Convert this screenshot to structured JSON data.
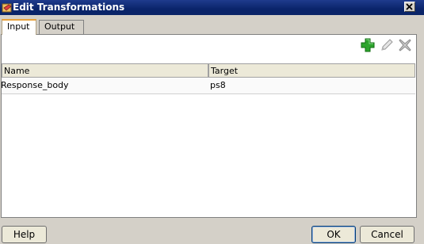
{
  "window": {
    "title": "Edit Transformations",
    "close_glyph": "×"
  },
  "tabs": [
    {
      "label": "Input",
      "active": true
    },
    {
      "label": "Output",
      "active": false
    }
  ],
  "toolbar": {
    "icons": [
      "add-icon",
      "edit-icon",
      "delete-icon"
    ],
    "add_color": "#2da42d"
  },
  "table": {
    "columns": [
      "Name",
      "Target"
    ],
    "rows": [
      {
        "name": "Response_body",
        "target": "ps8"
      }
    ]
  },
  "buttons": {
    "help": "Help",
    "ok": "OK",
    "cancel": "Cancel"
  }
}
